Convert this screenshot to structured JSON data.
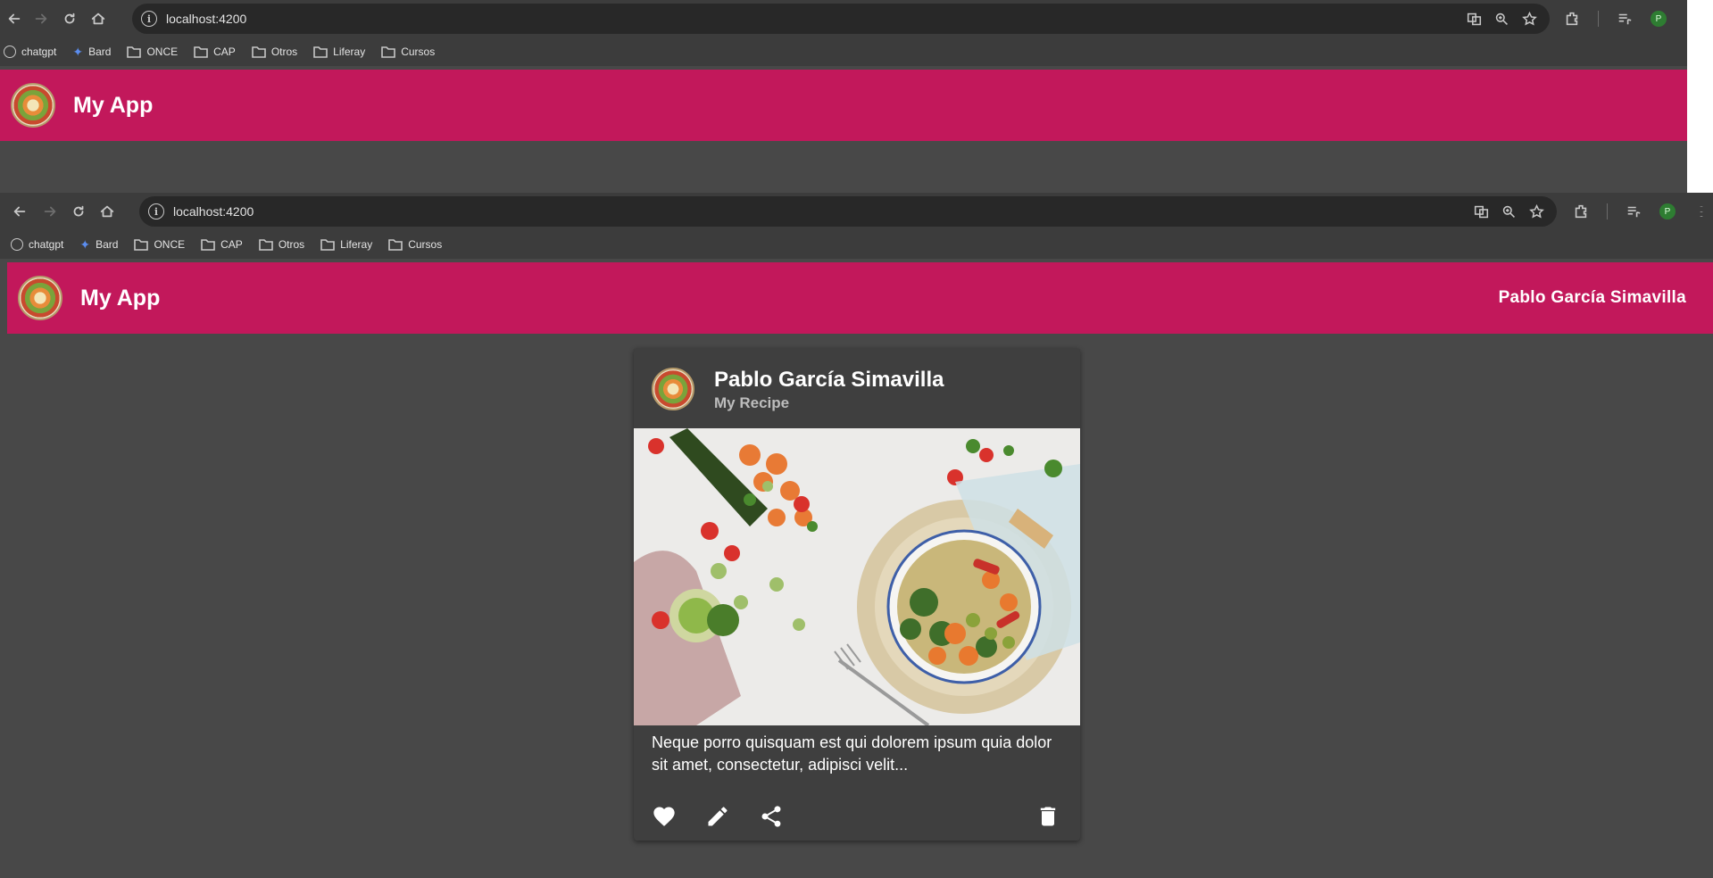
{
  "browser_back": {
    "url": "localhost:4200",
    "bookmarks": [
      "chatgpt",
      "Bard",
      "ONCE",
      "CAP",
      "Otros",
      "Liferay",
      "Cursos"
    ],
    "profile_initial": "P"
  },
  "browser_front": {
    "url": "localhost:4200",
    "bookmarks": [
      "chatgpt",
      "Bard",
      "ONCE",
      "CAP",
      "Otros",
      "Liferay",
      "Cursos"
    ],
    "profile_initial": "P"
  },
  "app_back": {
    "title": "My App"
  },
  "app": {
    "title": "My App",
    "user_name": "Pablo García Simavilla",
    "toolbar_color": "#c2185b"
  },
  "card": {
    "title": "Pablo García Simavilla",
    "subtitle": "My Recipe",
    "image_alt": "Bowl of quinoa with roasted vegetables surrounded by fresh tomatoes, carrots and herbs",
    "text": "Neque porro quisquam est qui dolorem ipsum quia dolor sit amet, consectetur, adipisci velit...",
    "actions": [
      "favorite-icon",
      "edit-icon",
      "share-icon",
      "delete-icon"
    ]
  }
}
